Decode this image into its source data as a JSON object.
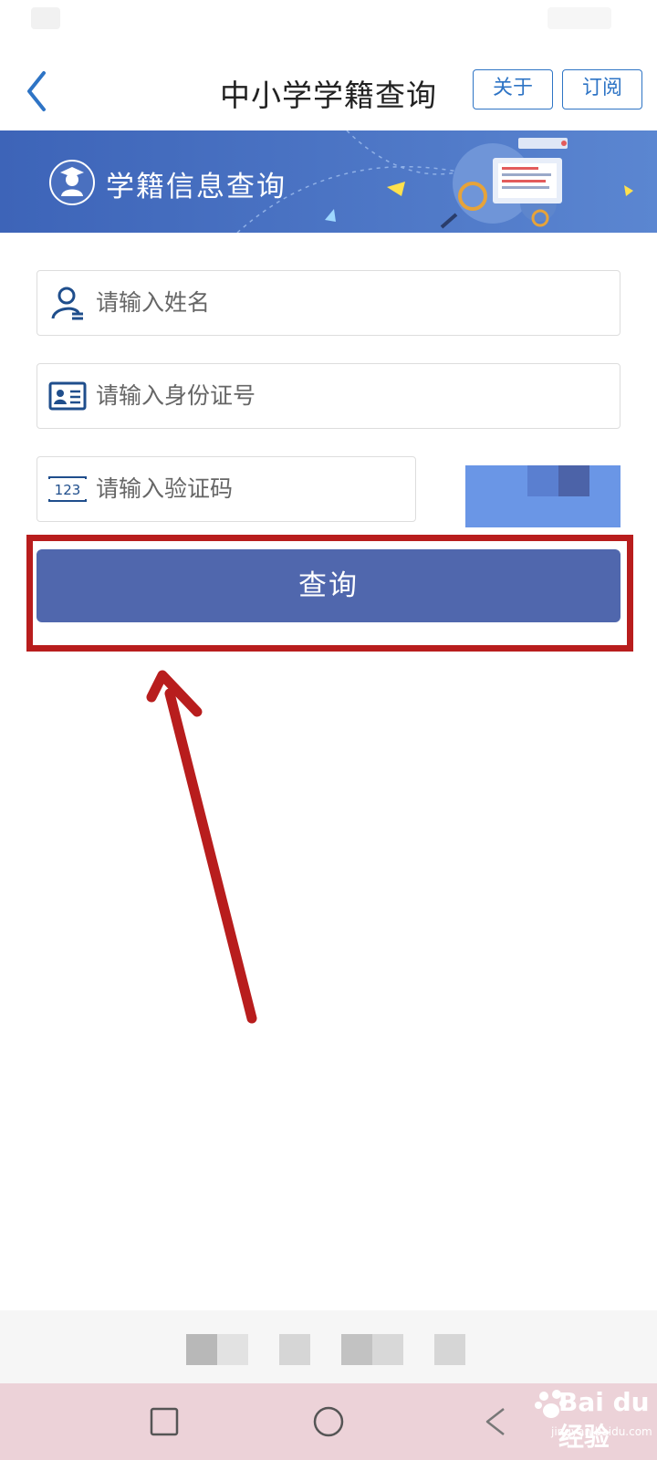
{
  "nav": {
    "title": "中小学学籍查询",
    "about_label": "关于",
    "subscribe_label": "订阅"
  },
  "banner": {
    "title": "学籍信息查询"
  },
  "form": {
    "name_placeholder": "请输入姓名",
    "id_placeholder": "请输入身份证号",
    "captcha_placeholder": "请输入验证码",
    "captcha_icon_text": "123",
    "submit_label": "查询"
  },
  "watermark": {
    "brand": "Bai du 经验",
    "url": "jingyan.baidu.com"
  },
  "colors": {
    "accent": "#2e74c5",
    "button": "#5067ad",
    "highlight": "#b81d1d",
    "banner": "#4b74c4"
  }
}
